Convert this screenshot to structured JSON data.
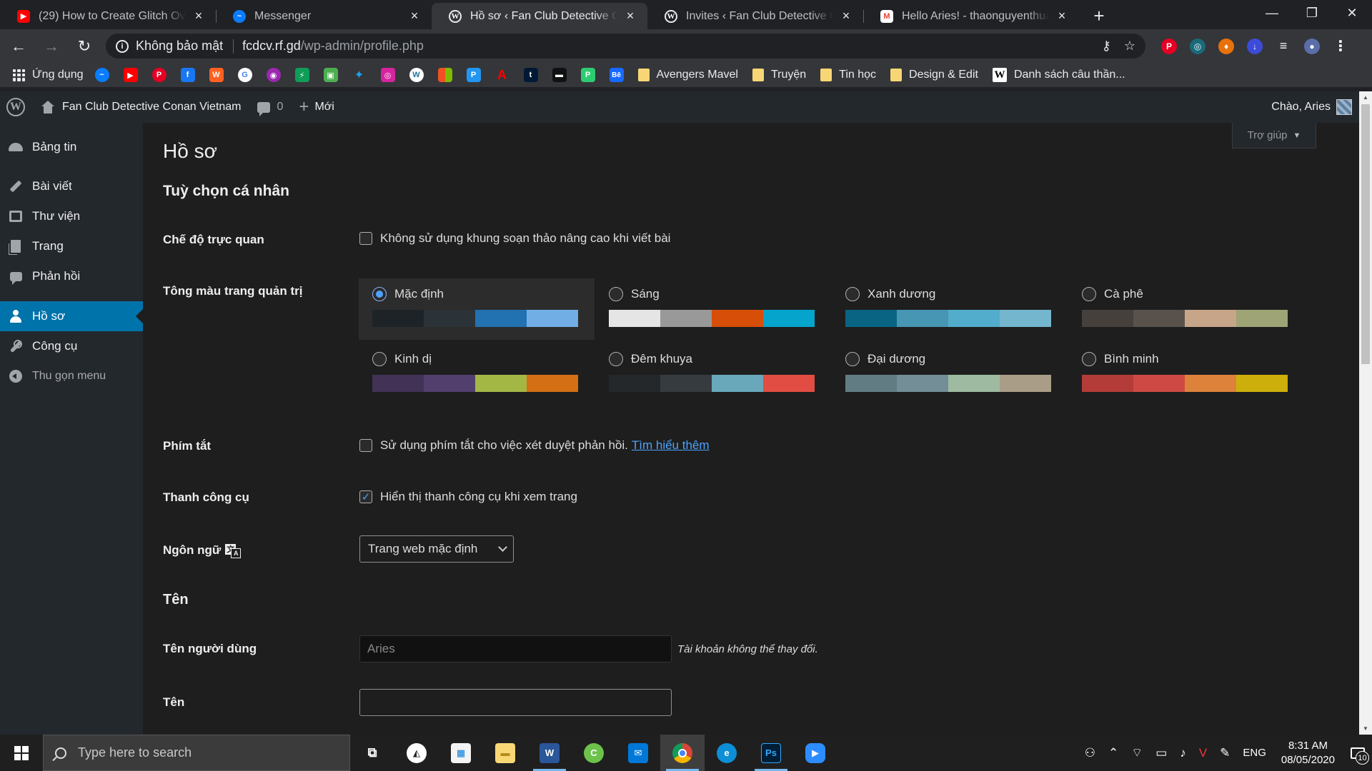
{
  "browser": {
    "tabs": [
      {
        "title": "(29) How to Create Glitch Overlay",
        "icon": "youtube-icon",
        "color": "#ff0000",
        "active": false
      },
      {
        "title": "Messenger",
        "icon": "messenger-icon",
        "color": "#0a7cff",
        "active": false
      },
      {
        "title": "Hồ sơ ‹ Fan Club Detective Conan",
        "icon": "wordpress-icon",
        "color": "#e8eaed",
        "active": true
      },
      {
        "title": "Invites ‹ Fan Club Detective Conan",
        "icon": "wordpress-icon",
        "color": "#e8eaed",
        "active": false
      },
      {
        "title": "Hello Aries! - thaonguyenthuarien",
        "icon": "gmail-icon",
        "color": "#ea4335",
        "active": false
      }
    ],
    "address": {
      "security": "Không bảo mật",
      "host": "fcdcv.rf.gd",
      "path": "/wp-admin/profile.php"
    },
    "bookmarks": {
      "apps_label": "Ứng dụng",
      "folders": [
        "Avengers Mavel",
        "Truyện",
        "Tin học",
        "Design & Edit"
      ],
      "wiki": "Danh sách câu thần..."
    }
  },
  "adminbar": {
    "site_name": "Fan Club Detective Conan Vietnam",
    "comments_count": "0",
    "new_label": "Mới",
    "greeting": "Chào, Aries"
  },
  "sidebar": {
    "items": [
      {
        "label": "Bảng tin",
        "icon": "dashboard-icon"
      },
      {
        "label": "Bài viết",
        "icon": "pin-icon"
      },
      {
        "label": "Thư viện",
        "icon": "media-icon"
      },
      {
        "label": "Trang",
        "icon": "page-icon"
      },
      {
        "label": "Phản hồi",
        "icon": "comment-icon"
      },
      {
        "label": "Hồ sơ",
        "icon": "user-icon",
        "current": true
      },
      {
        "label": "Công cụ",
        "icon": "wrench-icon"
      },
      {
        "label": "Thu gọn menu",
        "icon": "collapse-icon"
      }
    ]
  },
  "main": {
    "help_label": "Trợ giúp",
    "title": "Hồ sơ",
    "personal_options": "Tuỳ chọn cá nhân",
    "visual_editor": {
      "label": "Chế độ trực quan",
      "checkbox_label": "Không sử dụng khung soạn thảo nâng cao khi viết bài",
      "checked": false
    },
    "admin_color": {
      "label": "Tông màu trang quản trị",
      "schemes": [
        {
          "name": "Mặc định",
          "selected": true,
          "colors": [
            "#1d2327",
            "#2c3338",
            "#2271b1",
            "#72aee6"
          ]
        },
        {
          "name": "Sáng",
          "selected": false,
          "colors": [
            "#e5e5e5",
            "#999999",
            "#d64e07",
            "#04a4cc"
          ]
        },
        {
          "name": "Xanh dương",
          "selected": false,
          "colors": [
            "#096484",
            "#4796b3",
            "#52accc",
            "#74b6ce"
          ]
        },
        {
          "name": "Cà phê",
          "selected": false,
          "colors": [
            "#46403c",
            "#59524c",
            "#c7a589",
            "#9ea476"
          ]
        },
        {
          "name": "Kinh dị",
          "selected": false,
          "colors": [
            "#413256",
            "#523f6d",
            "#a3b745",
            "#d46f15"
          ]
        },
        {
          "name": "Đêm khuya",
          "selected": false,
          "colors": [
            "#25282b",
            "#363b3f",
            "#69a8bb",
            "#e14d43"
          ]
        },
        {
          "name": "Đại dương",
          "selected": false,
          "colors": [
            "#627c83",
            "#738e96",
            "#9ebaa0",
            "#aa9d88"
          ]
        },
        {
          "name": "Bình minh",
          "selected": false,
          "colors": [
            "#b43c38",
            "#cf4944",
            "#dd823b",
            "#ccaf0b"
          ]
        }
      ]
    },
    "shortcuts": {
      "label": "Phím tắt",
      "checkbox_label": "Sử dụng phím tắt cho việc xét duyệt phản hồi.",
      "link": "Tìm hiểu thêm",
      "checked": false
    },
    "toolbar": {
      "label": "Thanh công cụ",
      "checkbox_label": "Hiển thị thanh công cụ khi xem trang",
      "checked": true
    },
    "language": {
      "label": "Ngôn ngữ",
      "value": "Trang web mặc định"
    },
    "name_section": "Tên",
    "username": {
      "label": "Tên người dùng",
      "value": "Aries",
      "note": "Tài khoản không thể thay đổi."
    },
    "first_name": {
      "label": "Tên",
      "value": ""
    }
  },
  "taskbar": {
    "search_placeholder": "Type here to search",
    "language": "ENG",
    "time": "8:31 AM",
    "date": "08/05/2020",
    "notifications": "10"
  }
}
